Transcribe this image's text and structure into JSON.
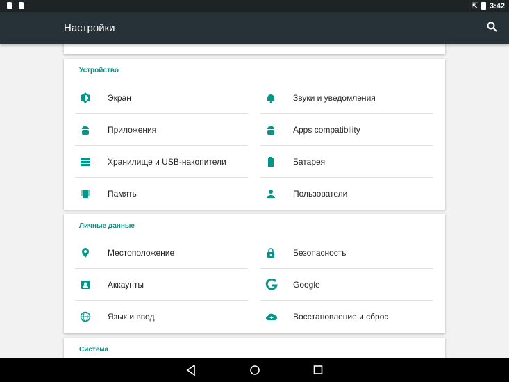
{
  "status": {
    "time": "3:42"
  },
  "toolbar": {
    "title": "Настройки",
    "search_icon": "search-icon"
  },
  "accent": "#009688",
  "sections": [
    {
      "title": "Устройство",
      "left": [
        {
          "label": "Экран",
          "icon": "brightness-icon"
        },
        {
          "label": "Приложения",
          "icon": "android-icon"
        },
        {
          "label": "Хранилище и USB-накопители",
          "icon": "storage-icon"
        },
        {
          "label": "Память",
          "icon": "memory-icon"
        }
      ],
      "right": [
        {
          "label": "Звуки и уведомления",
          "icon": "bell-icon"
        },
        {
          "label": "Apps compatibility",
          "icon": "android-icon"
        },
        {
          "label": "Батарея",
          "icon": "battery-icon"
        },
        {
          "label": "Пользователи",
          "icon": "person-icon"
        }
      ]
    },
    {
      "title": "Личные данные",
      "left": [
        {
          "label": "Местоположение",
          "icon": "location-icon"
        },
        {
          "label": "Аккаунты",
          "icon": "account-icon"
        },
        {
          "label": "Язык и ввод",
          "icon": "globe-icon"
        }
      ],
      "right": [
        {
          "label": "Безопасность",
          "icon": "lock-icon"
        },
        {
          "label": "Google",
          "icon": "google-icon"
        },
        {
          "label": "Восстановление и сброс",
          "icon": "cloud-upload-icon"
        }
      ]
    },
    {
      "title": "Система"
    }
  ]
}
